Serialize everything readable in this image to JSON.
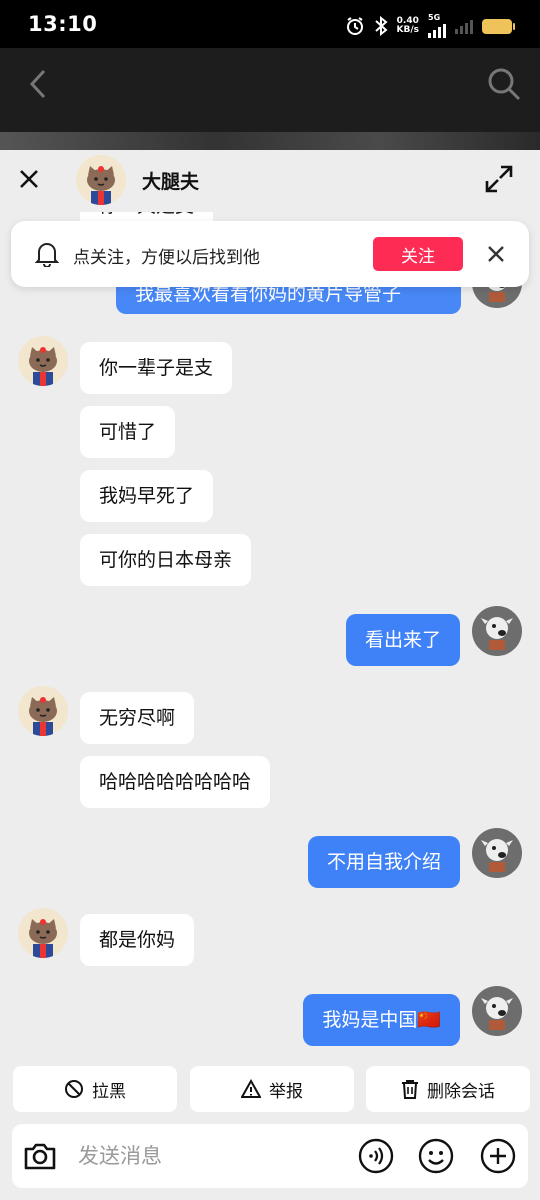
{
  "status_bar": {
    "time": "13:10",
    "speed_value": "0.40",
    "speed_unit": "KB/s",
    "network": "5G",
    "icons": [
      "alarm-icon",
      "bluetooth-icon",
      "signal-icon",
      "battery-icon"
    ]
  },
  "background_app": {
    "icons": [
      "back-arrow-icon",
      "search-icon"
    ]
  },
  "chat": {
    "peer_name": "大腿夫",
    "follow_banner": {
      "text": "点关注，方便以后找到他",
      "button_label": "关注"
    },
    "partial_messages": {
      "top_incoming": "你一天是支",
      "top_outgoing": "我最喜欢看看你妈的黄片导管子"
    },
    "messages": [
      {
        "sender": "peer",
        "text": "你一辈子是支"
      },
      {
        "sender": "peer",
        "text": "可惜了"
      },
      {
        "sender": "peer",
        "text": "我妈早死了"
      },
      {
        "sender": "peer",
        "text": "可你的日本母亲"
      },
      {
        "sender": "me",
        "text": "看出来了"
      },
      {
        "sender": "peer",
        "text": "无穷尽啊"
      },
      {
        "sender": "peer",
        "text": "哈哈哈哈哈哈哈哈"
      },
      {
        "sender": "me",
        "text": "不用自我介绍"
      },
      {
        "sender": "peer",
        "text": "都是你妈"
      },
      {
        "sender": "me",
        "text": "我妈是中国🇨🇳"
      }
    ]
  },
  "actions": {
    "block_label": "拉黑",
    "report_label": "举报",
    "delete_label": "删除会话"
  },
  "composer": {
    "placeholder": "发送消息",
    "icons": [
      "camera-icon",
      "voice-icon",
      "emoji-icon",
      "plus-icon"
    ]
  },
  "colors": {
    "outgoing_bubble": "#3f82f7",
    "follow_button": "#fe2c55",
    "background": "#ededee"
  }
}
